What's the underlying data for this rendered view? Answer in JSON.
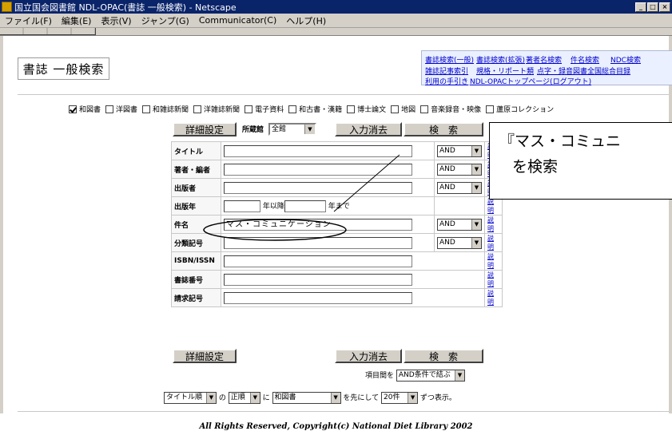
{
  "window": {
    "title": "国立国会図書館 NDL-OPAC(書誌 一般検索) - Netscape",
    "min": "_",
    "max": "□",
    "close": "×"
  },
  "menu": [
    "ファイル(F)",
    "編集(E)",
    "表示(V)",
    "ジャンプ(G)",
    "Communicator(C)",
    "ヘルプ(H)"
  ],
  "page": {
    "title": "書誌 一般検索"
  },
  "nav": {
    "row1": [
      "書誌検索(一般)",
      "書誌検索(拡張)",
      "著者名検索",
      "件名検索",
      "NDC検索"
    ],
    "row2": [
      "雑誌記事索引",
      "規格・リポート類",
      "点字・録音図書全国総合目録"
    ],
    "row3": [
      "利用の手引き",
      "NDL-OPACトップページ(ログアウト)"
    ]
  },
  "databases": [
    {
      "label": "和図書",
      "checked": true
    },
    {
      "label": "洋図書",
      "checked": false
    },
    {
      "label": "和雑誌新聞",
      "checked": false
    },
    {
      "label": "洋雑誌新聞",
      "checked": false
    },
    {
      "label": "電子資料",
      "checked": false
    },
    {
      "label": "和古書・漢籍",
      "checked": false
    },
    {
      "label": "博士論文",
      "checked": false
    },
    {
      "label": "地図",
      "checked": false
    },
    {
      "label": "音楽録音・映像",
      "checked": false
    },
    {
      "label": "蘆原コレクション",
      "checked": false
    }
  ],
  "form": {
    "detail_button": "詳細設定",
    "library_label": "所蔵館",
    "library_value": "全館",
    "clear_button": "入力消去",
    "search_button": "検　索",
    "help": "説明",
    "fields": {
      "title": {
        "label": "タイトル",
        "value": "",
        "op": "AND"
      },
      "author": {
        "label": "著者・編者",
        "value": "",
        "op": "AND"
      },
      "publisher": {
        "label": "出版者",
        "value": "",
        "op": "AND"
      },
      "year": {
        "label": "出版年",
        "from_suffix": "年以降",
        "to_suffix": "年まで"
      },
      "subject": {
        "label": "件名",
        "value": "マス・コミュニケーション",
        "op": "AND"
      },
      "classification": {
        "label": "分類記号",
        "value": "",
        "op": "AND"
      },
      "isbn": {
        "label": "ISBN/ISSN",
        "value": ""
      },
      "bib_no": {
        "label": "書誌番号",
        "value": ""
      },
      "call_no": {
        "label": "請求記号",
        "value": ""
      }
    },
    "combine_label": "項目間を",
    "combine_value": "AND条件で結ぶ",
    "sort": {
      "order_value": "タイトル順",
      "no": "の",
      "direction_value": "正順",
      "ni": "に",
      "first_value": "和図書",
      "first_suffix": "を先にして",
      "count_value": "20件",
      "count_suffix": "ずつ表示。"
    }
  },
  "footer": "All Rights Reserved, Copyright(c) National Diet Library 2002",
  "callout": {
    "line1": "『マス・コミュニ",
    "line2": "を検索"
  }
}
